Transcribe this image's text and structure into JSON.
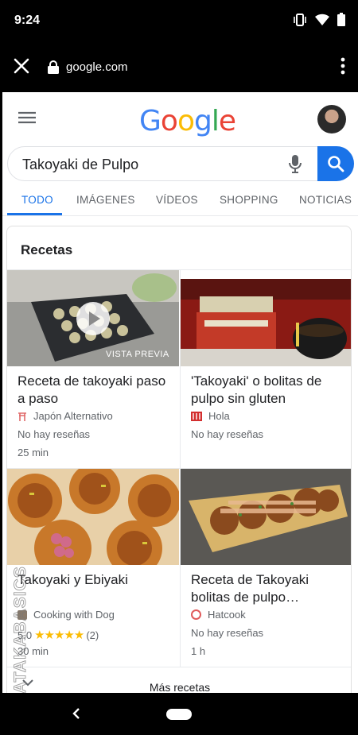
{
  "status_bar": {
    "time": "9:24"
  },
  "browser": {
    "url": "google.com"
  },
  "header": {
    "logo": [
      {
        "ch": "G",
        "color": "#4285F4"
      },
      {
        "ch": "o",
        "color": "#EA4335"
      },
      {
        "ch": "o",
        "color": "#FBBC05"
      },
      {
        "ch": "g",
        "color": "#4285F4"
      },
      {
        "ch": "l",
        "color": "#34A853"
      },
      {
        "ch": "e",
        "color": "#EA4335"
      }
    ]
  },
  "search": {
    "query": "Takoyaki de Pulpo"
  },
  "tabs": [
    "TODO",
    "IMÁGENES",
    "VÍDEOS",
    "SHOPPING",
    "NOTICIAS"
  ],
  "recipes_card": {
    "title": "Recetas",
    "items": [
      {
        "name": "Receta de takoyaki paso a paso",
        "source": "Japón Alternativo",
        "reviews": "No hay reseñas",
        "time": "25 min",
        "badge": "VISTA PREVIA"
      },
      {
        "name": "'Takoyaki' o bolitas de pulpo sin gluten",
        "source": "Hola",
        "reviews": "No hay reseñas",
        "time": ""
      },
      {
        "name": "Takoyaki y Ebiyaki",
        "source": "Cooking with Dog",
        "rating": "5,0",
        "rating_stars": 5,
        "rating_count": "(2)",
        "time": "30 min"
      },
      {
        "name": "Receta de Takoyaki bolitas de pulpo…",
        "source": "Hatcook",
        "reviews": "No hay reseñas",
        "time": "1 h"
      }
    ],
    "more_label": "Más recetas"
  },
  "watermark": "XATAKABASICS",
  "colors": {
    "accent": "#1a73e8",
    "star": "#fbbc04"
  }
}
